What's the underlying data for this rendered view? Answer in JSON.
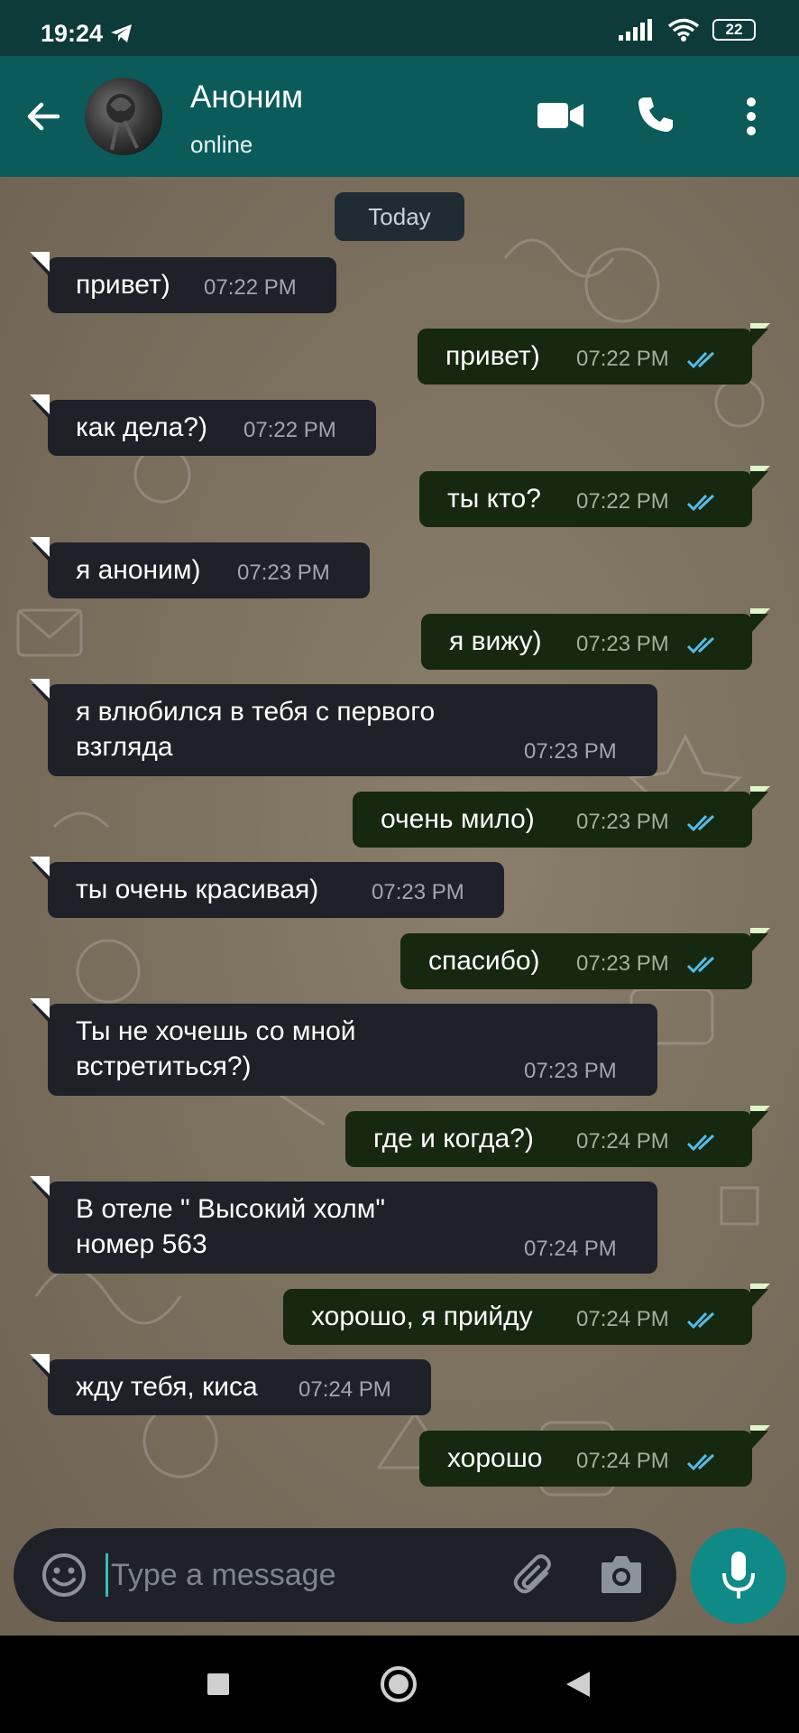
{
  "status_bar": {
    "time": "19:24",
    "battery": "22"
  },
  "header": {
    "contact_name": "Аноним",
    "contact_status": "online"
  },
  "chat": {
    "date_chip": "Today",
    "messages": [
      {
        "dir": "in",
        "lines": [
          "привет)"
        ],
        "time": "07:22 PM"
      },
      {
        "dir": "out",
        "lines": [
          "привет)"
        ],
        "time": "07:22 PM"
      },
      {
        "dir": "in",
        "lines": [
          "как дела?)"
        ],
        "time": "07:22 PM"
      },
      {
        "dir": "out",
        "lines": [
          "ты кто?"
        ],
        "time": "07:22 PM"
      },
      {
        "dir": "in",
        "lines": [
          "я аноним)"
        ],
        "time": "07:23 PM"
      },
      {
        "dir": "out",
        "lines": [
          "я вижу)"
        ],
        "time": "07:23 PM"
      },
      {
        "dir": "in",
        "lines": [
          "я влюбился в тебя с первого",
          "взгляда"
        ],
        "time": "07:23 PM"
      },
      {
        "dir": "out",
        "lines": [
          "очень мило)"
        ],
        "time": "07:23 PM"
      },
      {
        "dir": "in",
        "lines": [
          "ты очень красивая)"
        ],
        "time": "07:23 PM"
      },
      {
        "dir": "out",
        "lines": [
          "спасибо)"
        ],
        "time": "07:23 PM"
      },
      {
        "dir": "in",
        "lines": [
          "Ты не хочешь со мной",
          "встретиться?)"
        ],
        "time": "07:23 PM"
      },
      {
        "dir": "out",
        "lines": [
          "где и когда?)"
        ],
        "time": "07:24 PM"
      },
      {
        "dir": "in",
        "lines": [
          "В отеле \" Высокий холм\"",
          "номер 563"
        ],
        "time": "07:24 PM"
      },
      {
        "dir": "out",
        "lines": [
          "хорошо, я прийду"
        ],
        "time": "07:24 PM"
      },
      {
        "dir": "in",
        "lines": [
          "жду тебя, киса"
        ],
        "time": "07:24 PM"
      },
      {
        "dir": "out",
        "lines": [
          "хорошо"
        ],
        "time": "07:24 PM"
      }
    ]
  },
  "input": {
    "placeholder": "Type a message"
  },
  "icons": {
    "back": "arrow-left-icon",
    "video": "video-call-icon",
    "call": "phone-icon",
    "menu": "more-vert-icon",
    "emoji": "emoji-icon",
    "attach": "paperclip-icon",
    "camera": "camera-icon",
    "mic": "microphone-icon",
    "read": "double-check-icon"
  },
  "colors": {
    "header": "#0b5b5b",
    "status_bar": "#0d3b3a",
    "incoming_bubble": "#1f2129",
    "outgoing_bubble": "#16280f",
    "read_ticks": "#53bdeb",
    "mic_button": "#0f8a86"
  }
}
